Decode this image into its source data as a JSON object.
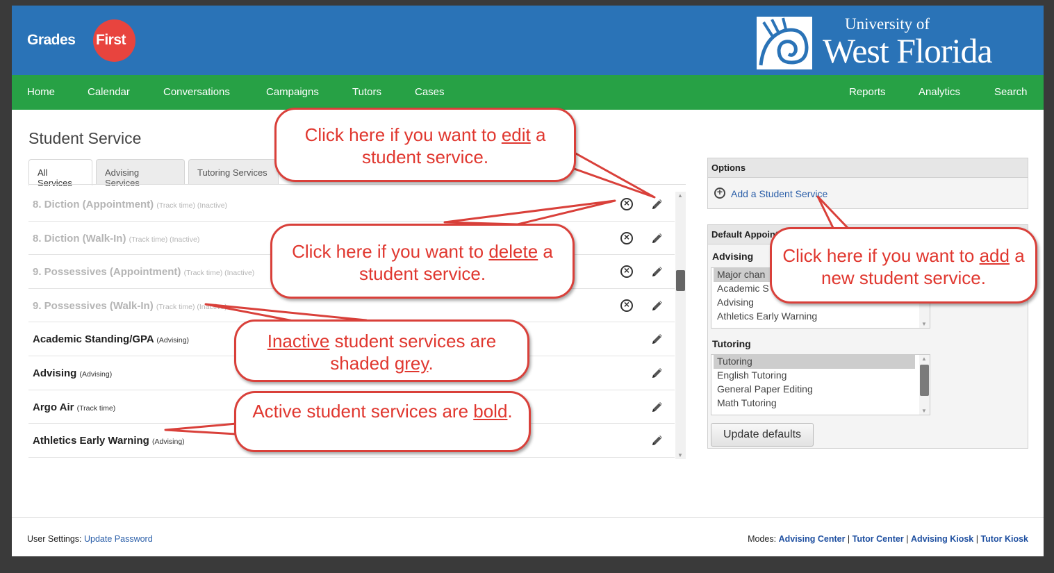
{
  "header": {
    "brand_left": "Grades",
    "brand_right": "First",
    "university_line1": "University of",
    "university_line2": "West Florida"
  },
  "nav": {
    "left": [
      "Home",
      "Calendar",
      "Conversations",
      "Campaigns",
      "Tutors",
      "Cases"
    ],
    "right": [
      "Reports",
      "Analytics",
      "Search"
    ]
  },
  "page": {
    "title": "Student Service",
    "tabs": [
      "All Services",
      "Advising Services",
      "Tutoring Services"
    ]
  },
  "services": [
    {
      "name": "8. Diction (Appointment)",
      "meta": "(Track time) (Inactive)",
      "inactive": true,
      "deletable": true
    },
    {
      "name": "8. Diction (Walk-In)",
      "meta": "(Track time) (Inactive)",
      "inactive": true,
      "deletable": true
    },
    {
      "name": "9. Possessives (Appointment)",
      "meta": "(Track time) (Inactive)",
      "inactive": true,
      "deletable": true
    },
    {
      "name": "9. Possessives (Walk-In)",
      "meta": "(Track time) (Inactive)",
      "inactive": true,
      "deletable": true
    },
    {
      "name": "Academic Standing/GPA",
      "meta": "(Advising)",
      "inactive": false,
      "deletable": false
    },
    {
      "name": "Advising",
      "meta": "(Advising)",
      "inactive": false,
      "deletable": false
    },
    {
      "name": "Argo Air",
      "meta": "(Track time)",
      "inactive": false,
      "deletable": false
    },
    {
      "name": "Athletics Early Warning",
      "meta": "(Advising)",
      "inactive": false,
      "deletable": false
    }
  ],
  "options": {
    "title": "Options",
    "add_link": "Add a Student Service"
  },
  "defaults": {
    "title": "Default Appoint",
    "advising_label": "Advising",
    "advising_options": [
      "Major chan",
      "Academic S",
      "Advising",
      "Athletics Early Warning"
    ],
    "tutoring_label": "Tutoring",
    "tutoring_options": [
      "Tutoring",
      "English Tutoring",
      "General Paper Editing",
      "Math Tutoring"
    ],
    "update_button": "Update defaults"
  },
  "footer": {
    "user_settings_label": "User Settings:",
    "update_password": "Update Password",
    "modes_label": "Modes:",
    "modes": [
      "Advising Center",
      "Tutor Center",
      "Advising Kiosk",
      "Tutor Kiosk"
    ],
    "separator": "|"
  },
  "callouts": {
    "edit": {
      "pre": "Click here if you want to ",
      "u": "edit",
      "post": " a student service."
    },
    "delete": {
      "pre": "Click here if you want to ",
      "u": "delete",
      "post": " a student service."
    },
    "add": {
      "pre": "Click here if you want to ",
      "u": "add",
      "post": " a new student service."
    },
    "inactive": {
      "pre": "",
      "u": "Inactive",
      "mid": " student services are shaded ",
      "u2": "grey",
      "post": "."
    },
    "active": {
      "pre": "Active student services are ",
      "u": "bold",
      "post": "."
    }
  },
  "colors": {
    "header_blue": "#2a73b7",
    "nav_green": "#27a145",
    "brand_red": "#e8443e",
    "callout_red": "#d9403a",
    "link_blue": "#2a5ea8"
  }
}
